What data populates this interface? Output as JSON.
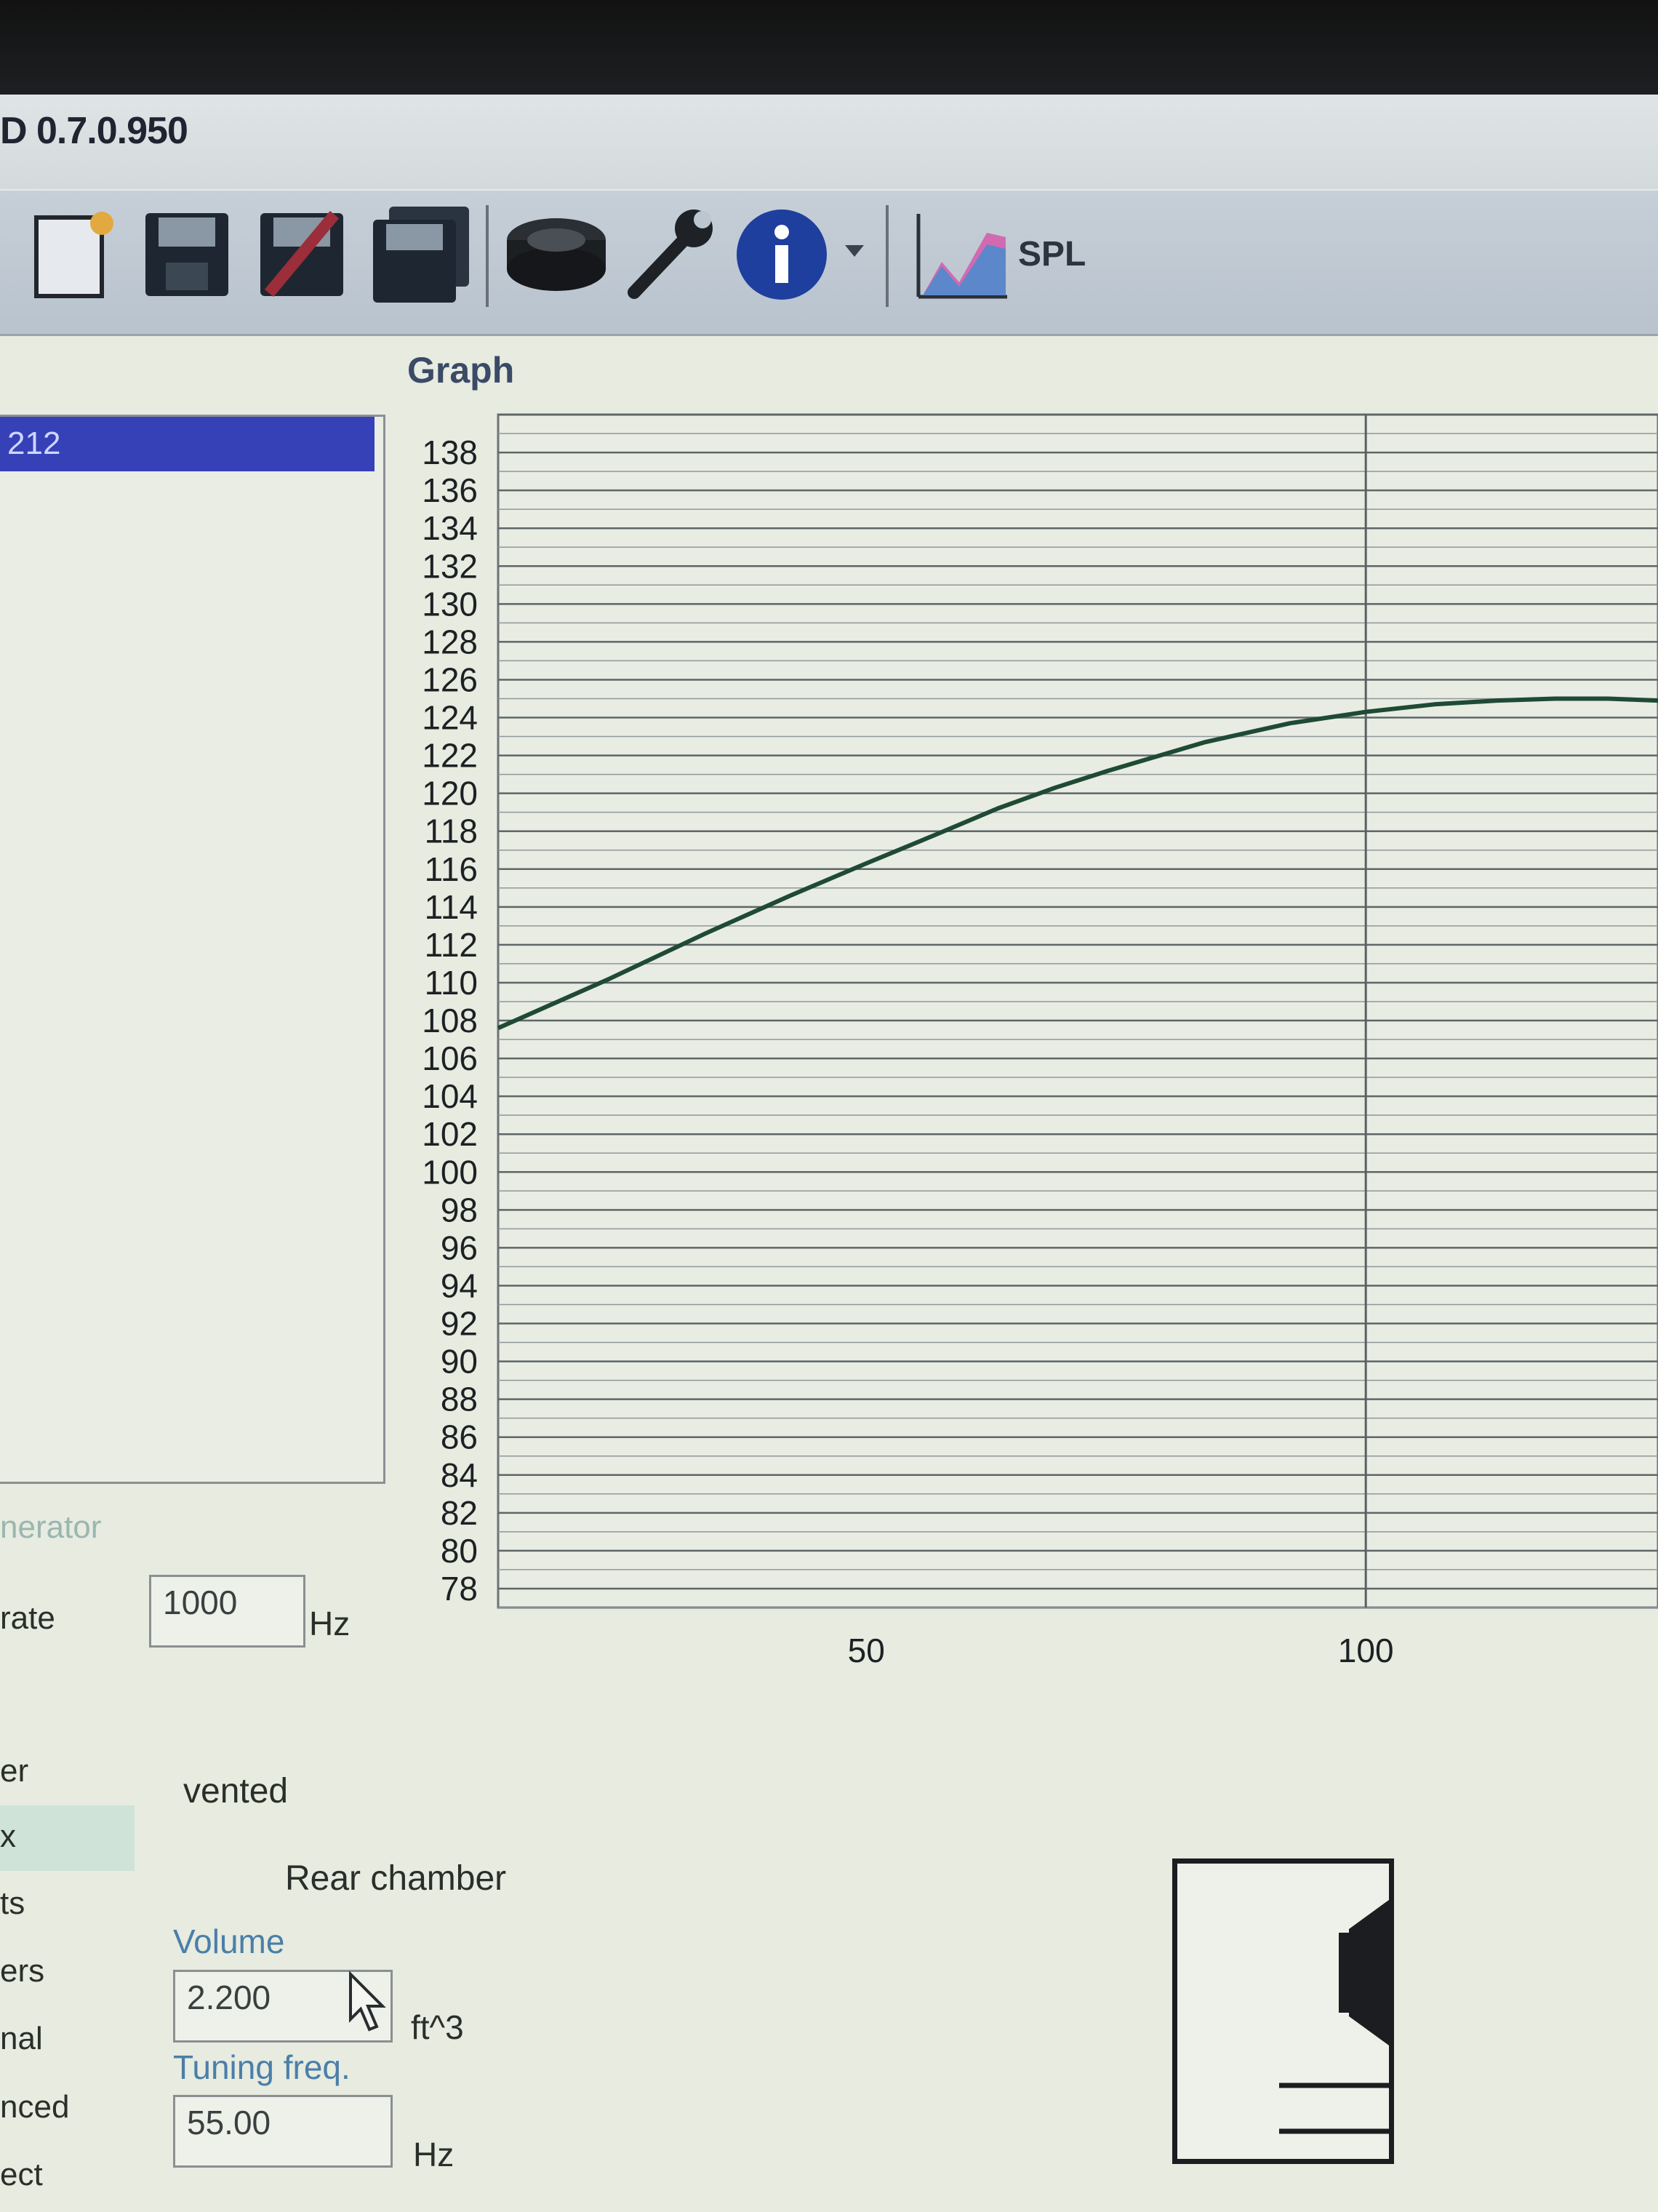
{
  "window": {
    "title": "D 0.7.0.950"
  },
  "toolbar": {
    "spl_label": "SPL",
    "icons": [
      "new-file-icon",
      "save-icon",
      "save-as-icon",
      "save-all-icon",
      "speaker-driver-icon",
      "wrench-icon",
      "info-icon",
      "dropdown-arrow-icon",
      "spl-graph-icon"
    ]
  },
  "driver_list": {
    "selected_item": "212"
  },
  "generator": {
    "heading": "nerator",
    "rate_label": "rate",
    "rate_value": "1000",
    "rate_unit": "Hz"
  },
  "nav": {
    "items": [
      "er",
      "x",
      "ts",
      "ers",
      "nal",
      "nced",
      "ect"
    ],
    "active_index": 1
  },
  "box": {
    "type_label": "vented",
    "chamber_label": "Rear chamber",
    "volume_label": "Volume",
    "volume_value": "2.200",
    "volume_unit": "ft^3",
    "tuning_label": "Tuning freq.",
    "tuning_value": "55.00",
    "tuning_unit": "Hz"
  },
  "graph": {
    "heading": "Graph"
  },
  "chart_data": {
    "type": "line",
    "title": "",
    "xlabel": "",
    "ylabel": "",
    "x_scale": "log",
    "xlim": [
      30,
      150
    ],
    "ylim": [
      77,
      140
    ],
    "x_ticks": [
      50,
      100
    ],
    "y_ticks": [
      78,
      80,
      82,
      84,
      86,
      88,
      90,
      92,
      94,
      96,
      98,
      100,
      102,
      104,
      106,
      108,
      110,
      112,
      114,
      116,
      118,
      120,
      122,
      124,
      126,
      128,
      130,
      132,
      134,
      136,
      138
    ],
    "grid": true,
    "series": [
      {
        "color": "#1f4a35",
        "x": [
          30,
          35,
          40,
          45,
          50,
          55,
          60,
          65,
          70,
          80,
          90,
          100,
          110,
          120,
          130,
          140,
          150
        ],
        "y": [
          107.6,
          110.2,
          112.6,
          114.6,
          116.3,
          117.8,
          119.2,
          120.3,
          121.2,
          122.7,
          123.7,
          124.3,
          124.7,
          124.9,
          125.0,
          125.0,
          124.9
        ]
      }
    ]
  }
}
